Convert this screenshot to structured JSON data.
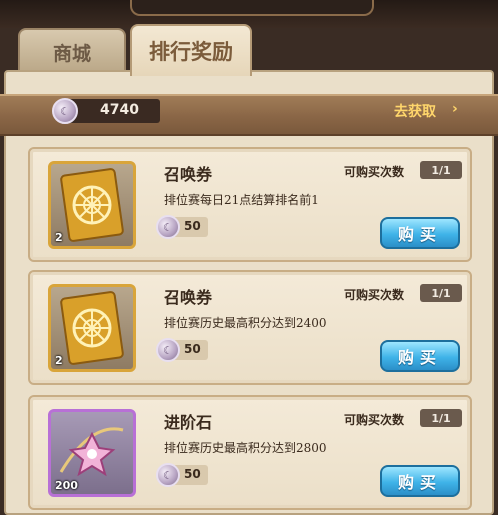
{
  "tabs": [
    {
      "label": "商城",
      "active": false
    },
    {
      "label": "排行奖励",
      "active": true
    }
  ],
  "currency": {
    "icon": "silver-coin-icon",
    "amount": "4740",
    "get_more_label": "去获取",
    "get_more_arrow": "›"
  },
  "items": [
    {
      "name": "召唤券",
      "icon": "summon-ticket-icon",
      "count": "2",
      "limit_label": "可购买次数",
      "limit_value": "1/1",
      "description": "排位赛每日21点结算排名前1",
      "price": "50",
      "buy_label": "购买"
    },
    {
      "name": "召唤券",
      "icon": "summon-ticket-icon",
      "count": "2",
      "limit_label": "可购买次数",
      "limit_value": "1/1",
      "description": "排位赛历史最高积分达到2400",
      "price": "50",
      "buy_label": "购买"
    },
    {
      "name": "进阶石",
      "icon": "advancement-stone-icon",
      "count": "200",
      "limit_label": "可购买次数",
      "limit_value": "1/1",
      "description": "排位赛历史最高积分达到2800",
      "price": "50",
      "buy_label": "购买"
    }
  ],
  "colors": {
    "accent_gold": "#ffd66b",
    "buy_button": "#3fb3e8",
    "panel_bg": "#eadfc9"
  }
}
